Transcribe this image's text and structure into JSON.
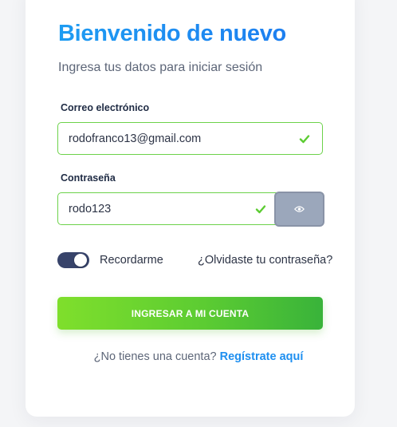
{
  "header": {
    "title": "Bienvenido de nuevo",
    "subtitle": "Ingresa tus datos para iniciar sesión"
  },
  "form": {
    "email": {
      "label": "Correo electrónico",
      "value": "rodofranco13@gmail.com",
      "status": "valid"
    },
    "password": {
      "label": "Contraseña",
      "value": "rodo123",
      "status": "valid",
      "toggle_icon": "eye-icon"
    },
    "remember": {
      "label": "Recordarme",
      "checked": true
    },
    "forgot_link": "¿Olvidaste tu contraseña?",
    "submit_label": "INGRESAR A MI CUENTA"
  },
  "footer": {
    "prompt": "¿No tienes una cuenta?",
    "register_link": "Regístrate aquí"
  },
  "colors": {
    "title_gradient_start": "#1e9cf2",
    "valid_border": "#6cd24a",
    "check": "#5ccc32",
    "toggle_on": "#37436a",
    "button_gradient_start": "#7fdf2c",
    "button_gradient_end": "#39b33a",
    "link": "#1e8ff0"
  }
}
